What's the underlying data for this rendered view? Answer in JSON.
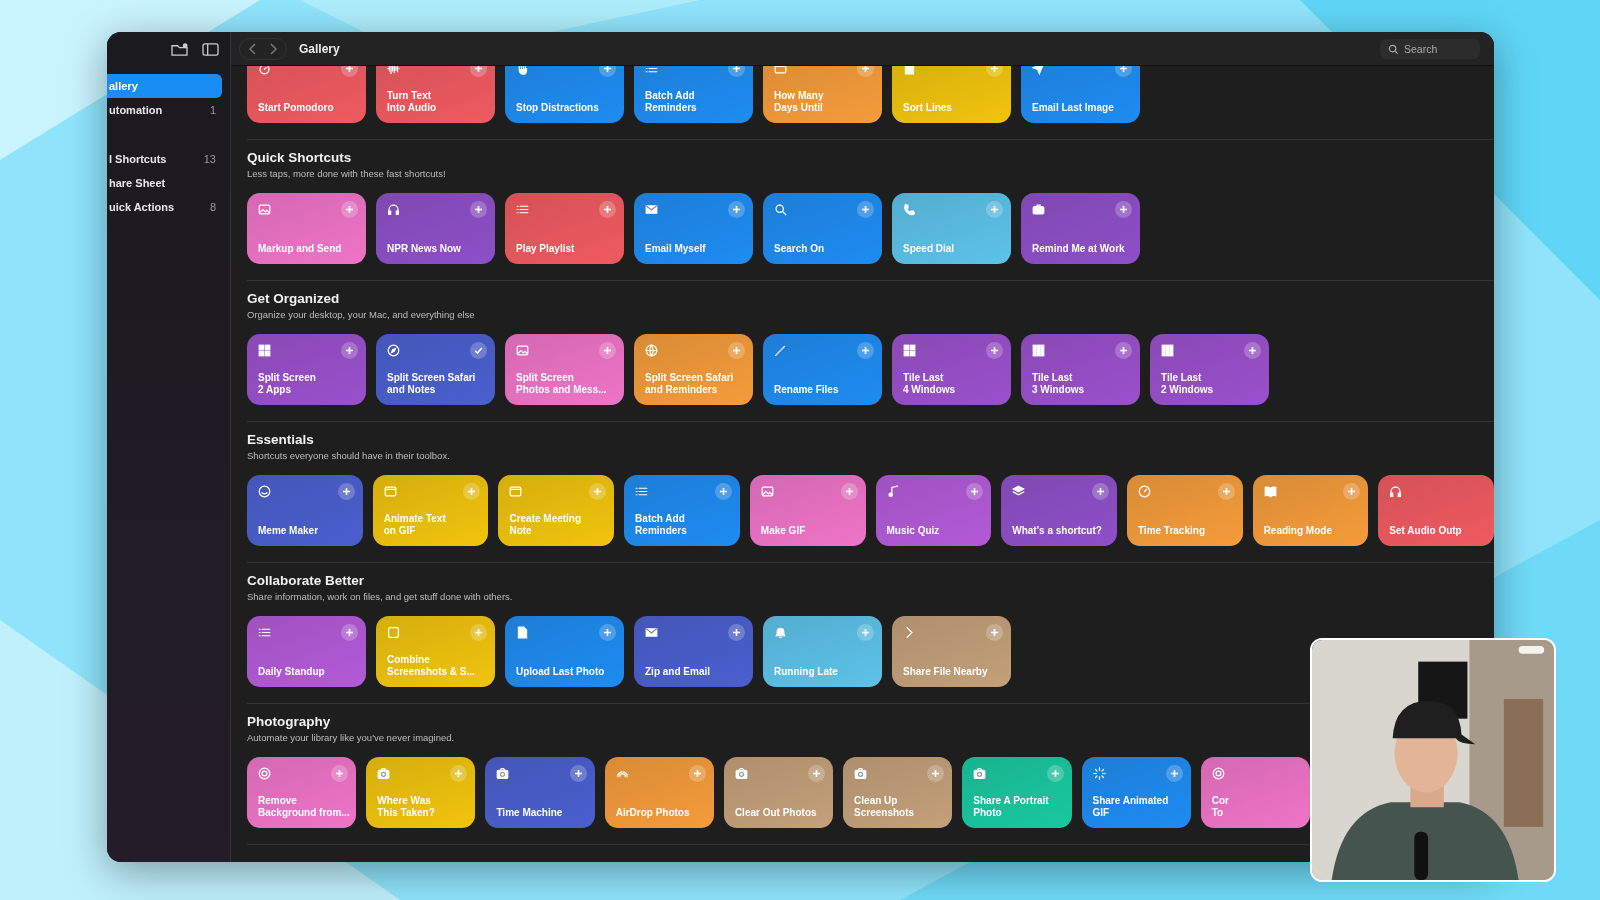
{
  "window": {
    "title": "Gallery",
    "search": {
      "placeholder": "Search"
    }
  },
  "sidebar": {
    "items": [
      {
        "label": "allery",
        "selected": true
      },
      {
        "label": "utomation",
        "count": "1",
        "selected": false
      },
      {
        "label": "l Shortcuts",
        "count": "13",
        "selected": false
      },
      {
        "label": "hare Sheet",
        "selected": false
      },
      {
        "label": "uick Actions",
        "count": "8",
        "selected": false
      }
    ]
  },
  "sections": [
    {
      "cards": [
        {
          "lines": [
            "Start Pomodoro"
          ],
          "color": "#ef5a60",
          "added": false
        },
        {
          "lines": [
            "Turn Text",
            "Into Audio"
          ],
          "color": "#ef5a60",
          "added": false
        },
        {
          "lines": [
            "Stop Distractions"
          ],
          "color": "#1d8cf2",
          "added": false
        },
        {
          "lines": [
            "Batch Add",
            "Reminders"
          ],
          "color": "#1d8cf2",
          "added": false
        },
        {
          "lines": [
            "How Many",
            "Days Until"
          ],
          "color": "#f59c3a",
          "added": false
        },
        {
          "lines": [
            "Sort Lines"
          ],
          "color": "#f1c40c",
          "added": false
        },
        {
          "lines": [
            "Email Last Image"
          ],
          "color": "#1d8cf2",
          "added": false
        }
      ]
    },
    {
      "title": "Quick Shortcuts",
      "subtitle": "Less taps, more done with these fast shortcuts!",
      "cards": [
        {
          "lines": [
            "Markup and Send"
          ],
          "color": "#ef74c8",
          "added": false
        },
        {
          "lines": [
            "NPR News Now"
          ],
          "color": "#8e4fc8",
          "added": false
        },
        {
          "lines": [
            "Play Playlist"
          ],
          "color": "#ef5a60",
          "added": false
        },
        {
          "lines": [
            "Email Myself"
          ],
          "color": "#1d8cf2",
          "added": false
        },
        {
          "lines": [
            "Search On"
          ],
          "color": "#1d8cf2",
          "added": false
        },
        {
          "lines": [
            "Speed Dial"
          ],
          "color": "#5cc3ea",
          "added": false
        },
        {
          "lines": [
            "Remind Me at Work"
          ],
          "color": "#8e4fc8",
          "added": false
        }
      ]
    },
    {
      "title": "Get Organized",
      "subtitle": "Organize your desktop, your Mac, and everything else",
      "cards": [
        {
          "lines": [
            "Split Screen",
            "2 Apps"
          ],
          "color": "#9a50cc",
          "added": false
        },
        {
          "lines": [
            "Split Screen Safari",
            "and Notes"
          ],
          "color": "#4a5fcf",
          "added": true
        },
        {
          "lines": [
            "Split Screen",
            "Photos and Mess..."
          ],
          "color": "#ef74c8",
          "added": false
        },
        {
          "lines": [
            "Split Screen Safari",
            "and Reminders"
          ],
          "color": "#f59c3a",
          "added": false
        },
        {
          "lines": [
            "Rename Files"
          ],
          "color": "#1d8cf2",
          "added": false
        },
        {
          "lines": [
            "Tile Last",
            "4 Windows"
          ],
          "color": "#9a50cc",
          "added": false
        },
        {
          "lines": [
            "Tile Last",
            "3 Windows"
          ],
          "color": "#9a50cc",
          "added": false
        },
        {
          "lines": [
            "Tile Last",
            "2 Windows"
          ],
          "color": "#9a50cc",
          "added": false
        }
      ]
    },
    {
      "title": "Essentials",
      "subtitle": "Shortcuts everyone should have in their toolbox.",
      "cards": [
        {
          "lines": [
            "Meme Maker"
          ],
          "color": "#4a5fcf",
          "added": false
        },
        {
          "lines": [
            "Animate Text",
            "on GIF"
          ],
          "color": "#f1c40c",
          "added": false
        },
        {
          "lines": [
            "Create Meeting",
            "Note"
          ],
          "color": "#f1c40c",
          "added": false
        },
        {
          "lines": [
            "Batch Add",
            "Reminders"
          ],
          "color": "#1d8cf2",
          "added": false
        },
        {
          "lines": [
            "Make GIF"
          ],
          "color": "#ef74c8",
          "added": false
        },
        {
          "lines": [
            "Music Quiz"
          ],
          "color": "#b35ad8",
          "added": false
        },
        {
          "lines": [
            "What's a shortcut?"
          ],
          "color": "#8e4fc8",
          "added": false
        },
        {
          "lines": [
            "Time Tracking"
          ],
          "color": "#f59c3a",
          "added": false
        },
        {
          "lines": [
            "Reading Mode"
          ],
          "color": "#f59c3a",
          "added": false
        },
        {
          "lines": [
            "Set Audio Outp"
          ],
          "color": "#ef5a60"
        }
      ]
    },
    {
      "title": "Collaborate Better",
      "subtitle": "Share information, work on files, and get stuff done with others.",
      "cards": [
        {
          "lines": [
            "Daily Standup"
          ],
          "color": "#b35ad8",
          "added": false
        },
        {
          "lines": [
            "Combine",
            "Screenshots & S..."
          ],
          "color": "#f1c40c",
          "added": false
        },
        {
          "lines": [
            "Upload Last Photo"
          ],
          "color": "#1d8cf2",
          "added": false
        },
        {
          "lines": [
            "Zip and Email"
          ],
          "color": "#4a5fcf",
          "added": false
        },
        {
          "lines": [
            "Running Late"
          ],
          "color": "#5cc3ea",
          "added": false
        },
        {
          "lines": [
            "Share File Nearby"
          ],
          "color": "#c4a07a",
          "added": false
        }
      ]
    },
    {
      "title": "Photography",
      "subtitle": "Automate your library like you've never imagined.",
      "cards": [
        {
          "lines": [
            "Remove",
            "Background from..."
          ],
          "color": "#ef74c8",
          "added": false
        },
        {
          "lines": [
            "Where Was",
            "This Taken?"
          ],
          "color": "#f1c40c",
          "added": false
        },
        {
          "lines": [
            "Time Machine"
          ],
          "color": "#4a5fcf",
          "added": false
        },
        {
          "lines": [
            "AirDrop Photos"
          ],
          "color": "#f59c3a",
          "added": false
        },
        {
          "lines": [
            "Clear Out Photos"
          ],
          "color": "#c4a07a",
          "added": false
        },
        {
          "lines": [
            "Clean Up",
            "Screenshots"
          ],
          "color": "#c4a07a",
          "added": false
        },
        {
          "lines": [
            "Share A Portrait",
            "Photo"
          ],
          "color": "#18c9a0",
          "added": false
        },
        {
          "lines": [
            "Share Animated",
            "GIF"
          ],
          "color": "#1d8cf2",
          "added": false
        },
        {
          "lines": [
            "Cor",
            "To"
          ],
          "color": "#ef74c8"
        }
      ]
    }
  ]
}
